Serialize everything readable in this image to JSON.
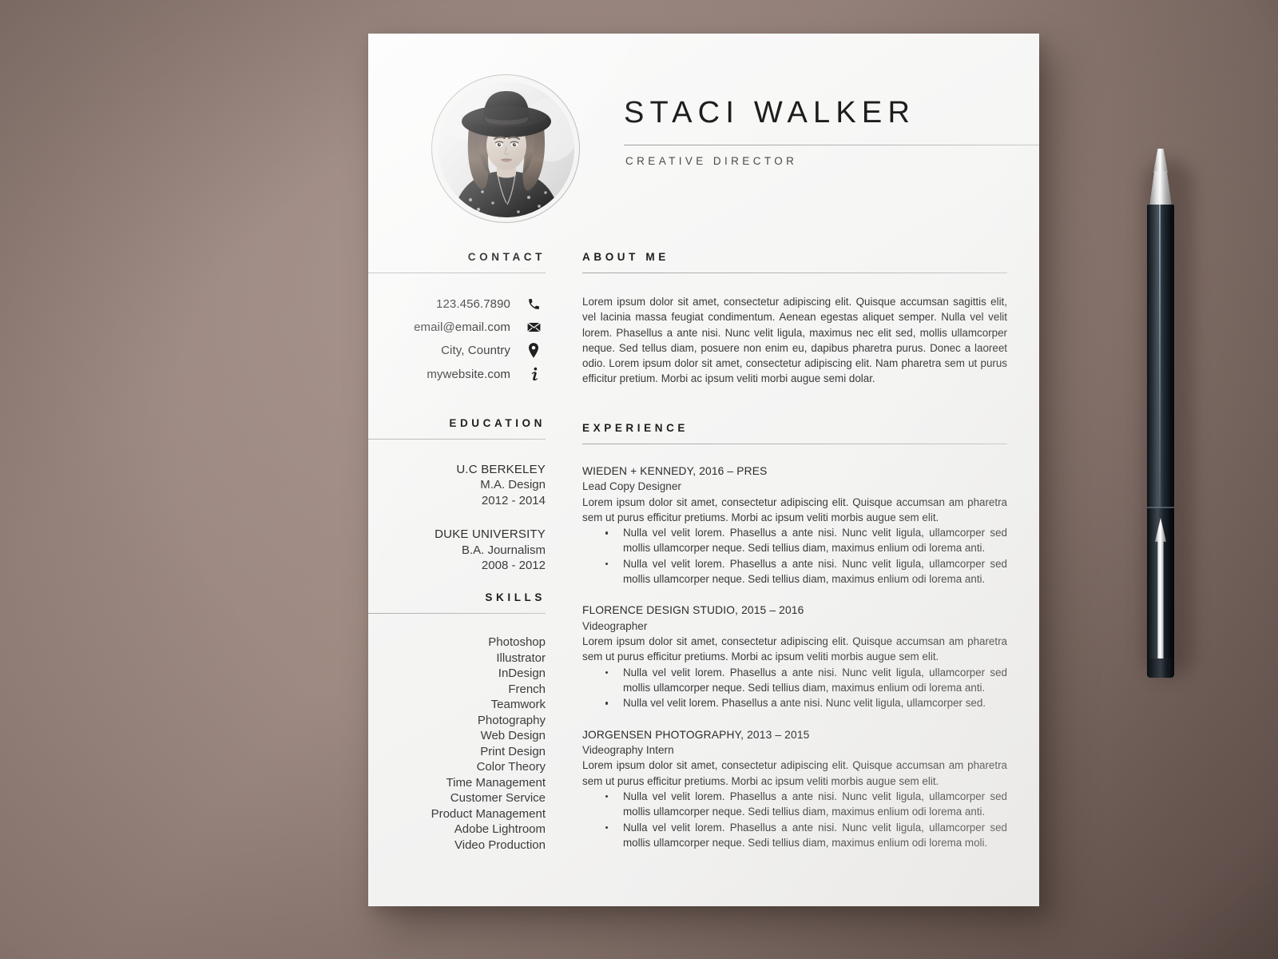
{
  "page": {
    "background_color": "#8d7b75",
    "paper_color": "#f7f7f6"
  },
  "header": {
    "name": "STACI WALKER",
    "role": "CREATIVE DIRECTOR",
    "photo_alt": "portrait-photo"
  },
  "contact": {
    "heading": "CONTACT",
    "items": [
      {
        "text": "123.456.7890",
        "icon": "phone-icon"
      },
      {
        "text": "email@email.com",
        "icon": "envelope-icon"
      },
      {
        "text": "City, Country",
        "icon": "location-pin-icon"
      },
      {
        "text": "mywebsite.com",
        "icon": "info-icon"
      }
    ]
  },
  "education": {
    "heading": "EDUCATION",
    "entries": [
      {
        "school": "U.C BERKELEY",
        "degree": "M.A. Design",
        "years": "2012 - 2014"
      },
      {
        "school": "DUKE UNIVERSITY",
        "degree": "B.A. Journalism",
        "years": "2008 - 2012"
      }
    ]
  },
  "skills": {
    "heading": "SKILLS",
    "items": [
      "Photoshop",
      "Illustrator",
      "InDesign",
      "French",
      "Teamwork",
      "Photography",
      "Web Design",
      "Print Design",
      "Color Theory",
      "Time Management",
      "Customer Service",
      "Product Management",
      "Adobe Lightroom",
      "Video Production"
    ]
  },
  "about": {
    "heading": "ABOUT ME",
    "text": "Lorem ipsum dolor sit amet, consectetur adipiscing elit. Quisque accumsan sagittis elit, vel lacinia massa feugiat condimentum. Aenean egestas aliquet semper. Nulla vel velit lorem. Phasellus a ante nisi. Nunc velit ligula, maximus nec elit sed, mollis ullamcorper neque. Sed tellus diam, posuere non enim eu, dapibus pharetra purus. Donec a laoreet odio. Lorem ipsum dolor sit amet, consectetur adipiscing elit. Nam pharetra sem ut purus efficitur pretium. Morbi ac ipsum veliti morbi augue semi dolar."
  },
  "experience": {
    "heading": "EXPERIENCE",
    "jobs": [
      {
        "title": "WIEDEN + KENNEDY, 2016 – PRES",
        "role": "Lead Copy Designer",
        "desc": "Lorem ipsum dolor sit amet, consectetur adipiscing elit. Quisque accumsan am pharetra sem ut purus efficitur pretiums. Morbi ac ipsum veliti morbis augue sem elit.",
        "bullets": [
          "Nulla vel velit lorem. Phasellus a ante nisi. Nunc velit ligula, ullamcorper sed mollis ullamcorper neque. Sedi tellius diam, maximus enlium odi lorema anti.",
          "Nulla vel velit lorem. Phasellus a ante nisi. Nunc velit ligula, ullamcorper sed mollis ullamcorper neque. Sedi tellius diam, maximus enlium odi lorema anti."
        ]
      },
      {
        "title": "FLORENCE DESIGN STUDIO, 2015 – 2016",
        "role": "Videographer",
        "desc": "Lorem ipsum dolor sit amet, consectetur adipiscing elit. Quisque accumsan am pharetra sem ut purus efficitur pretiums. Morbi ac ipsum veliti morbis augue sem elit.",
        "bullets": [
          "Nulla vel velit lorem. Phasellus a ante nisi. Nunc velit ligula, ullamcorper sed mollis ullamcorper neque. Sedi tellius diam, maximus enlium odi lorema anti.",
          "Nulla vel velit lorem. Phasellus a ante nisi. Nunc velit ligula, ullamcorper sed."
        ]
      },
      {
        "title": "JORGENSEN PHOTOGRAPHY, 2013 – 2015",
        "role": "Videography Intern",
        "desc": "Lorem ipsum dolor sit amet, consectetur adipiscing elit. Quisque accumsan am pharetra sem ut purus efficitur pretiums. Morbi ac ipsum veliti morbis augue sem elit.",
        "bullets": [
          "Nulla vel velit lorem. Phasellus a ante nisi. Nunc velit ligula, ullamcorper sed mollis ullamcorper neque. Sedi tellius diam, maximus enlium odi lorema anti.",
          "Nulla vel velit lorem. Phasellus a ante nisi. Nunc velit ligula, ullamcorper sed mollis ullamcorper neque. Sedi tellius diam, maximus enlium odi lorema moli."
        ]
      }
    ]
  },
  "desk_objects": {
    "pen": "black-fountain-pen"
  }
}
